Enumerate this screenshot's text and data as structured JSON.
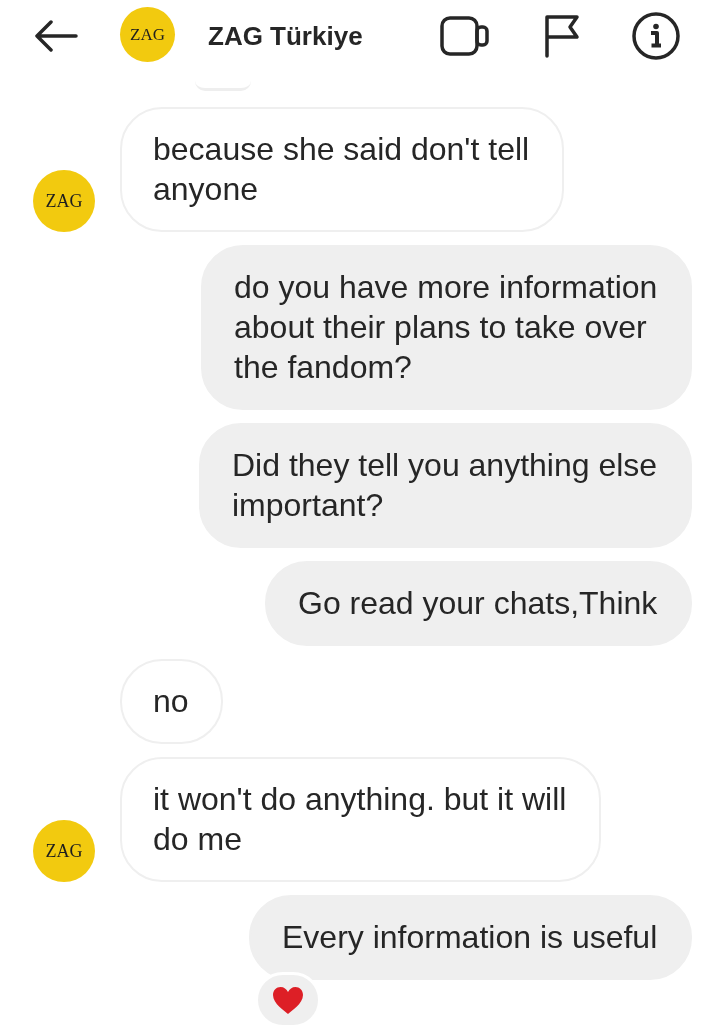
{
  "header": {
    "avatar": "ZAG",
    "title": "ZAG Türkiye"
  },
  "messages": [
    {
      "kind": "received",
      "text": "because she said don't tell anyone",
      "avatar": "ZAG"
    },
    {
      "kind": "sent",
      "text": "do you have more information about their plans to take over the fandom?"
    },
    {
      "kind": "sent",
      "text": "Did they tell you anything else important?"
    },
    {
      "kind": "sent",
      "text": "Go read your chats,Think"
    },
    {
      "kind": "received",
      "text": "no"
    },
    {
      "kind": "received",
      "text": "it won't do anything. but it will do me",
      "avatar": "ZAG"
    },
    {
      "kind": "sent",
      "text": "Every information is useful",
      "reaction": {
        "kind": "heart"
      }
    }
  ]
}
